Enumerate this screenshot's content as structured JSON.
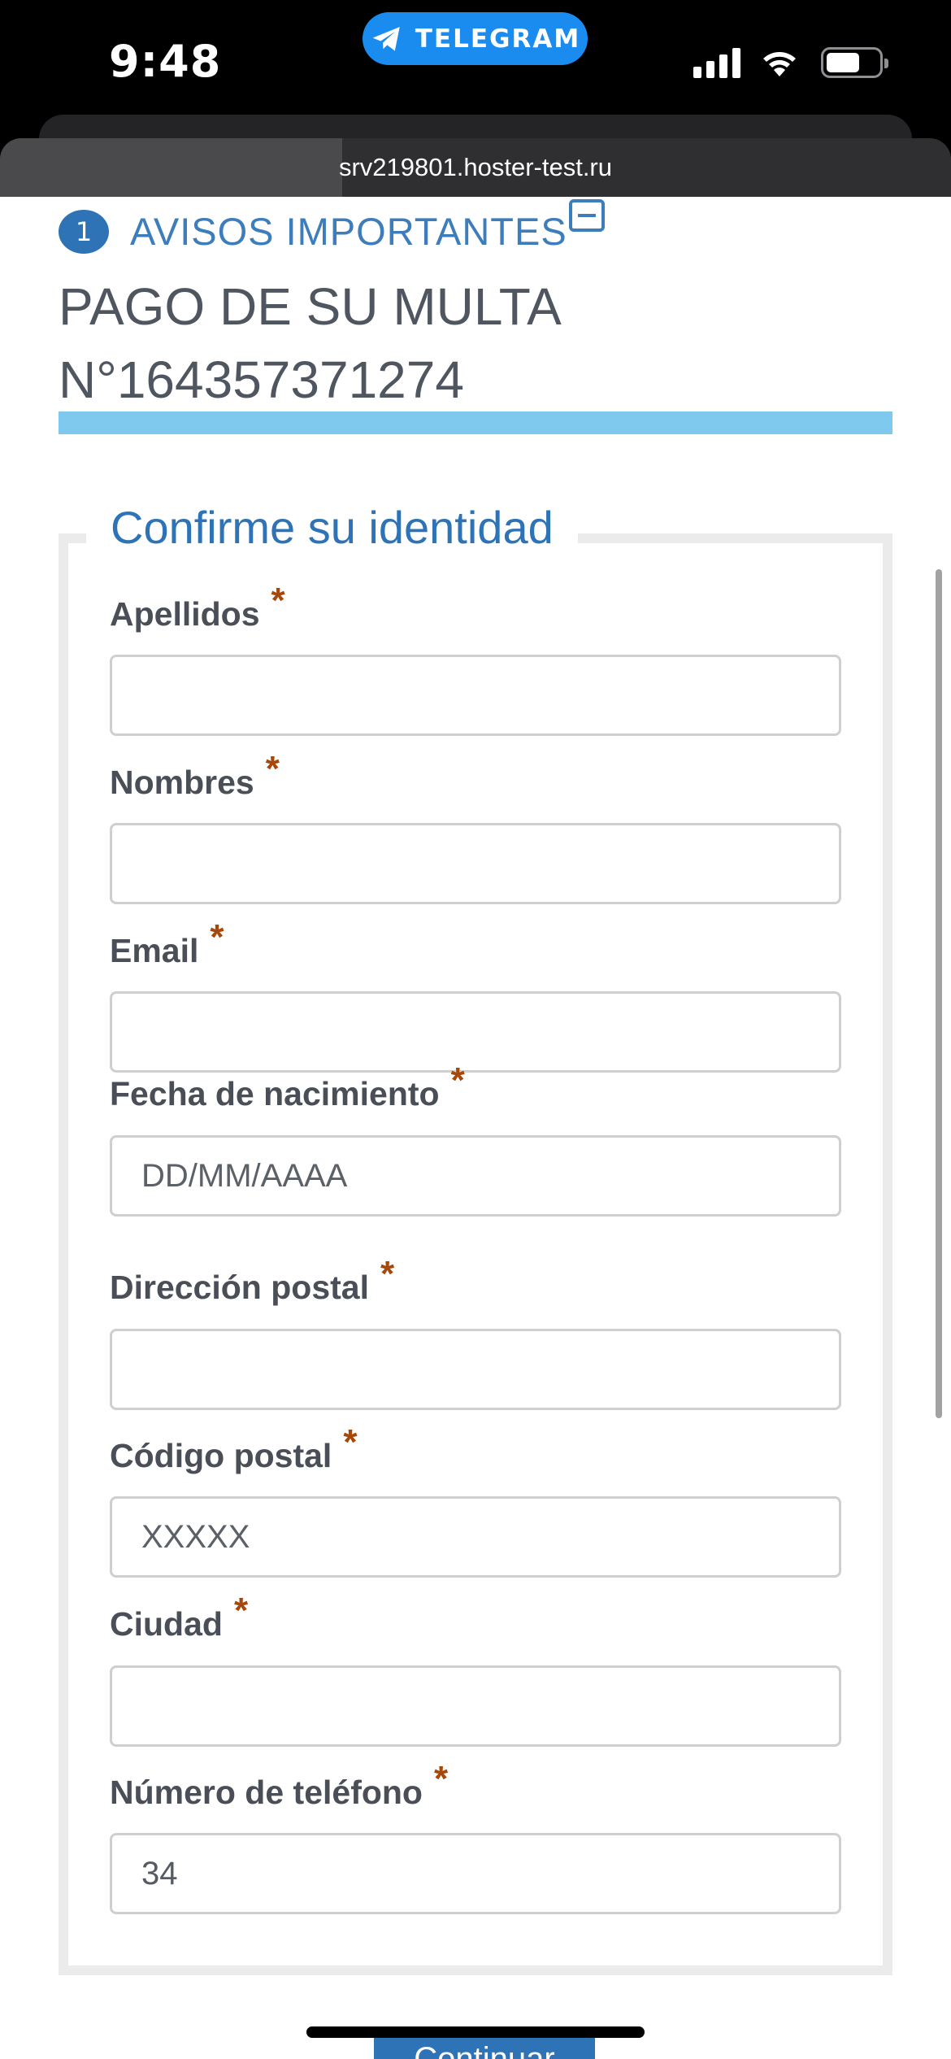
{
  "status_bar": {
    "time": "9:48",
    "back_app_label": "TELEGRAM",
    "back_app_icon": "telegram-plane-icon",
    "signal_icon": "cellular-signal-icon",
    "wifi_icon": "wifi-icon",
    "battery_icon": "battery-icon",
    "battery_level": 0.55
  },
  "browser": {
    "url": "srv219801.hoster-test.ru",
    "load_progress": 0.36
  },
  "notice": {
    "step_number": "1",
    "title": "AVISOS IMPORTANTES",
    "collapse_icon": "minus-square-icon"
  },
  "fine": {
    "line1": "PAGO DE SU MULTA",
    "line2": "N°164357371274"
  },
  "form": {
    "legend": "Confirme su identidad",
    "required_mark": "*",
    "fields": [
      {
        "label": "Apellidos",
        "placeholder": "",
        "value": ""
      },
      {
        "label": "Nombres",
        "placeholder": "",
        "value": ""
      },
      {
        "label": "Email",
        "placeholder": "",
        "value": ""
      },
      {
        "label": "Fecha de nacimiento",
        "placeholder": "DD/MM/AAAA",
        "value": ""
      },
      {
        "label": "Dirección postal",
        "placeholder": "",
        "value": ""
      },
      {
        "label": "Código postal",
        "placeholder": "XXXXX",
        "value": ""
      },
      {
        "label": "Ciudad",
        "placeholder": "",
        "value": ""
      },
      {
        "label": "Número de teléfono",
        "placeholder": "",
        "value": "34"
      }
    ],
    "submit_label": "Continuar"
  },
  "colors": {
    "accent_blue": "#2e73b6",
    "title_blue": "#3d7dbb",
    "rule_light_blue": "#7fc9ef",
    "required_orange": "#a8470a",
    "telegram_blue": "#1a8cf0"
  }
}
